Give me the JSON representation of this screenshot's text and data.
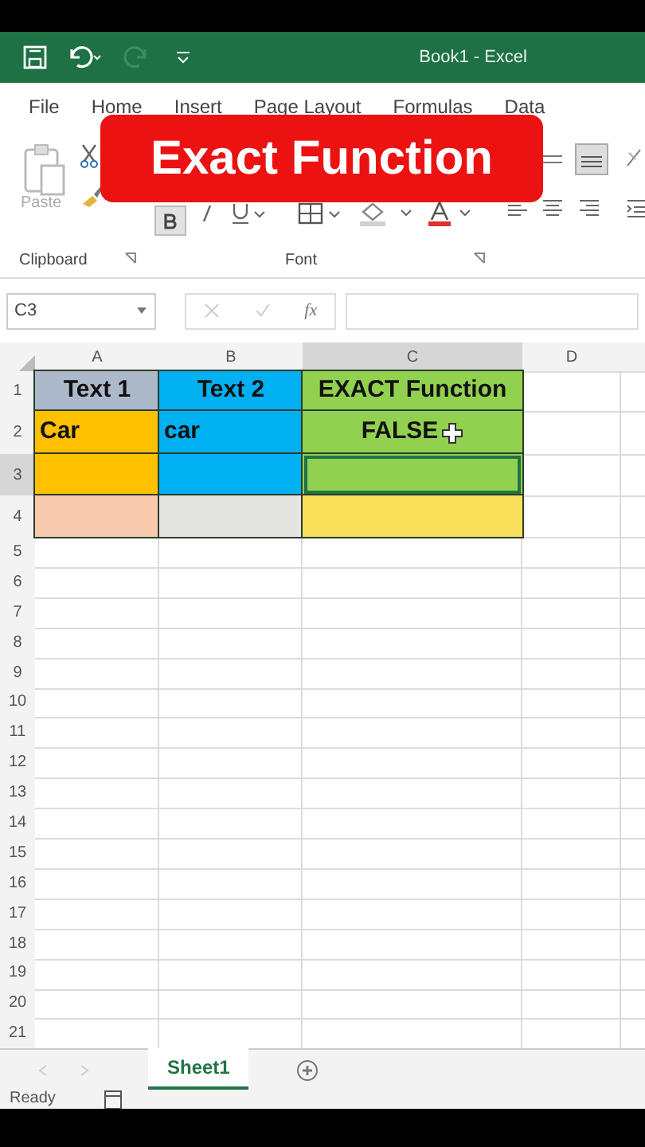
{
  "title_bar": {
    "title": "Book1  -  Excel"
  },
  "ribbon_tabs": [
    {
      "label": "File"
    },
    {
      "label": "Home"
    },
    {
      "label": "Insert"
    },
    {
      "label": "Page Layout"
    },
    {
      "label": "Formulas"
    },
    {
      "label": "Data"
    }
  ],
  "ribbon": {
    "paste_label": "Paste",
    "groups": [
      {
        "label": "Clipboard"
      },
      {
        "label": "Font"
      }
    ]
  },
  "overlay_title": "Exact Function",
  "formula_bar": {
    "name_box": "C3",
    "fx": "fx"
  },
  "columns": [
    {
      "label": "A",
      "selected": false
    },
    {
      "label": "B",
      "selected": false
    },
    {
      "label": "C",
      "selected": true
    },
    {
      "label": "D",
      "selected": false
    }
  ],
  "rows": [
    {
      "header": "1",
      "selected": false,
      "cells": [
        {
          "text": "Text 1",
          "color": "#acb9ca",
          "centered": true,
          "selected": false
        },
        {
          "text": "Text 2",
          "color": "#00b0f0",
          "centered": true,
          "selected": false
        },
        {
          "text": "EXACT Function",
          "color": "#92d050",
          "centered": true,
          "selected": false
        }
      ]
    },
    {
      "header": "2",
      "selected": false,
      "cells": [
        {
          "text": "Car",
          "color": "#ffc000",
          "centered": false,
          "selected": false
        },
        {
          "text": "car",
          "color": "#00b0f0",
          "centered": false,
          "selected": false
        },
        {
          "text": "FALSE",
          "color": "#92d050",
          "centered": true,
          "selected": false
        }
      ]
    },
    {
      "header": "3",
      "selected": true,
      "cells": [
        {
          "color": "#ffc000",
          "selected": false
        },
        {
          "color": "#00b0f0",
          "selected": false
        },
        {
          "color": "#92d050",
          "selected": true
        }
      ]
    },
    {
      "header": "4",
      "selected": false,
      "cells": [
        {
          "color": "#f8cbad",
          "selected": false
        },
        {
          "color": "#e4e4e2",
          "selected": false
        },
        {
          "color": "#f7e15a",
          "selected": false
        }
      ]
    }
  ],
  "empty_rows": [
    "5",
    "6",
    "7",
    "8",
    "9",
    "10",
    "11",
    "12",
    "13",
    "14",
    "15",
    "16",
    "17",
    "18",
    "19",
    "20",
    "21"
  ],
  "sheet_tabs": [
    {
      "label": "Sheet1",
      "selected": true
    }
  ],
  "status_bar": {
    "text": "Ready"
  }
}
